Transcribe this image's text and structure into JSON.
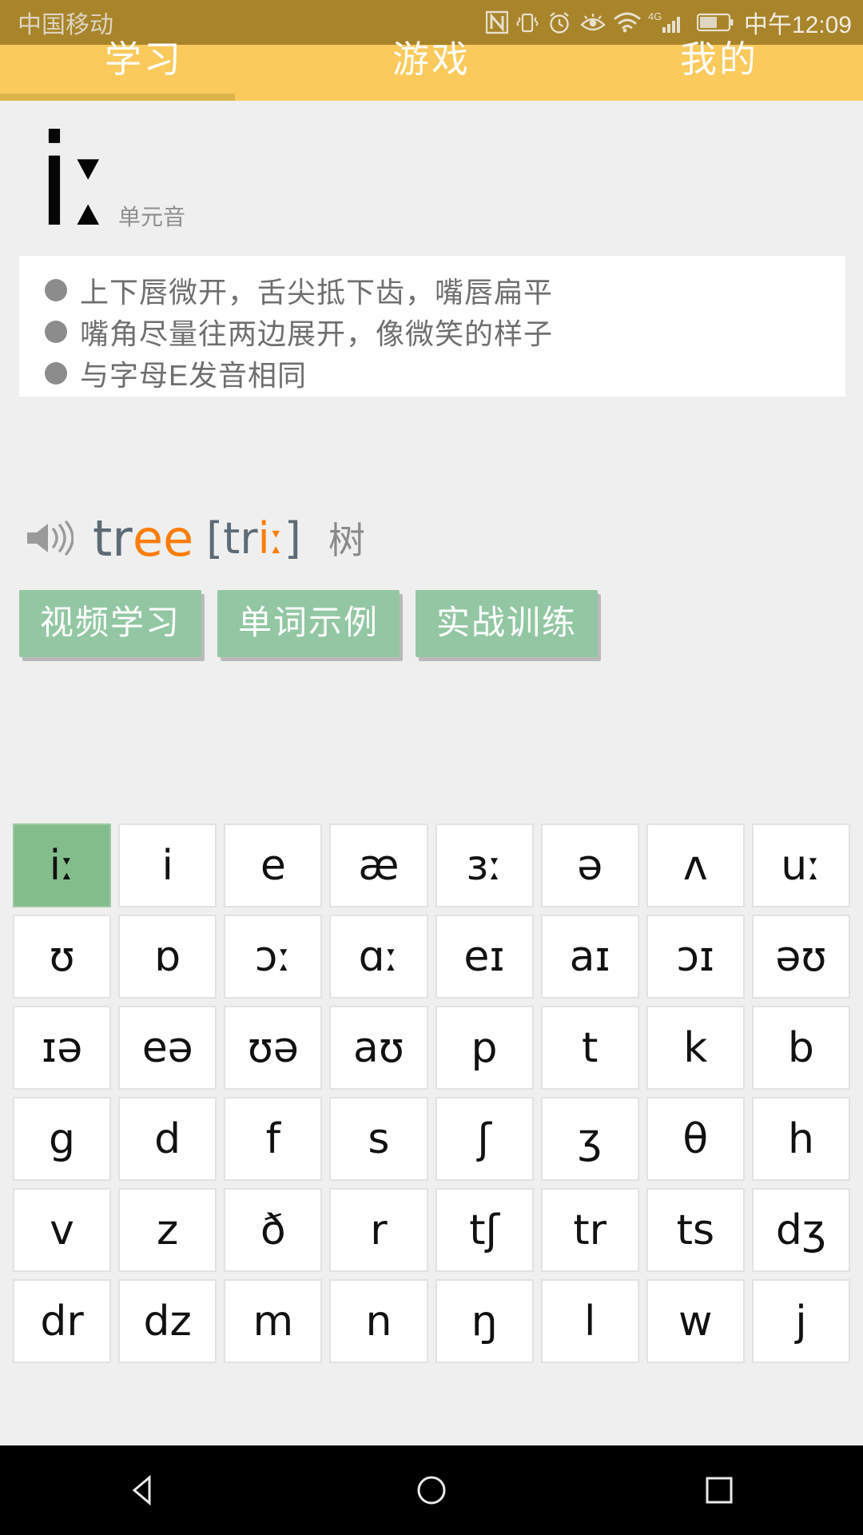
{
  "status_bar": {
    "carrier": "中国移动",
    "time": "中午12:09",
    "icons": [
      "nfc-icon",
      "vibrate-icon",
      "alarm-icon",
      "eye-icon",
      "wifi-icon",
      "signal-4g-icon",
      "battery-icon"
    ],
    "network": "4G",
    "background_color": "#a8842a"
  },
  "tabs": {
    "items": [
      {
        "label": "学习",
        "selected": true
      },
      {
        "label": "游戏",
        "selected": false
      },
      {
        "label": "我的",
        "selected": false
      }
    ],
    "bar_color": "#fbca5c",
    "indicator_color": "#ddb44a"
  },
  "header": {
    "symbol": "iː",
    "category": "单元音"
  },
  "description": {
    "lines": [
      "上下唇微开，舌尖抵下齿，嘴唇扁平",
      "嘴角尽量往两边展开，像微笑的样子",
      "与字母E发音相同"
    ]
  },
  "word_example": {
    "speaker_icon": "speaker-icon",
    "word_prefix": "tr",
    "word_highlight": "ee",
    "phonetic_open": "[tr",
    "phonetic_highlight": "iː",
    "phonetic_close": "]",
    "meaning": "树",
    "accent_color": "#fa7d08",
    "word_color": "#5d6b77"
  },
  "actions": {
    "buttons": [
      {
        "label": "视频学习"
      },
      {
        "label": "单词示例"
      },
      {
        "label": "实战训练"
      }
    ],
    "color": "#93c7a4"
  },
  "phonetic_grid": {
    "selected": "iː",
    "selected_color": "#83bd8c",
    "symbols": [
      "iː",
      "i",
      "e",
      "æ",
      "ɜː",
      "ə",
      "ʌ",
      "uː",
      "ʊ",
      "ɒ",
      "ɔː",
      "ɑː",
      "eɪ",
      "aɪ",
      "ɔɪ",
      "əʊ",
      "ɪə",
      "eə",
      "ʊə",
      "aʊ",
      "p",
      "t",
      "k",
      "b",
      "g",
      "d",
      "f",
      "s",
      "ʃ",
      "ʒ",
      "θ",
      "h",
      "v",
      "z",
      "ð",
      "r",
      "tʃ",
      "tr",
      "ts",
      "dʒ",
      "dr",
      "dz",
      "m",
      "n",
      "ŋ",
      "l",
      "w",
      "j"
    ]
  },
  "navbar": {
    "buttons": [
      "back-icon",
      "home-icon",
      "recents-icon"
    ]
  }
}
